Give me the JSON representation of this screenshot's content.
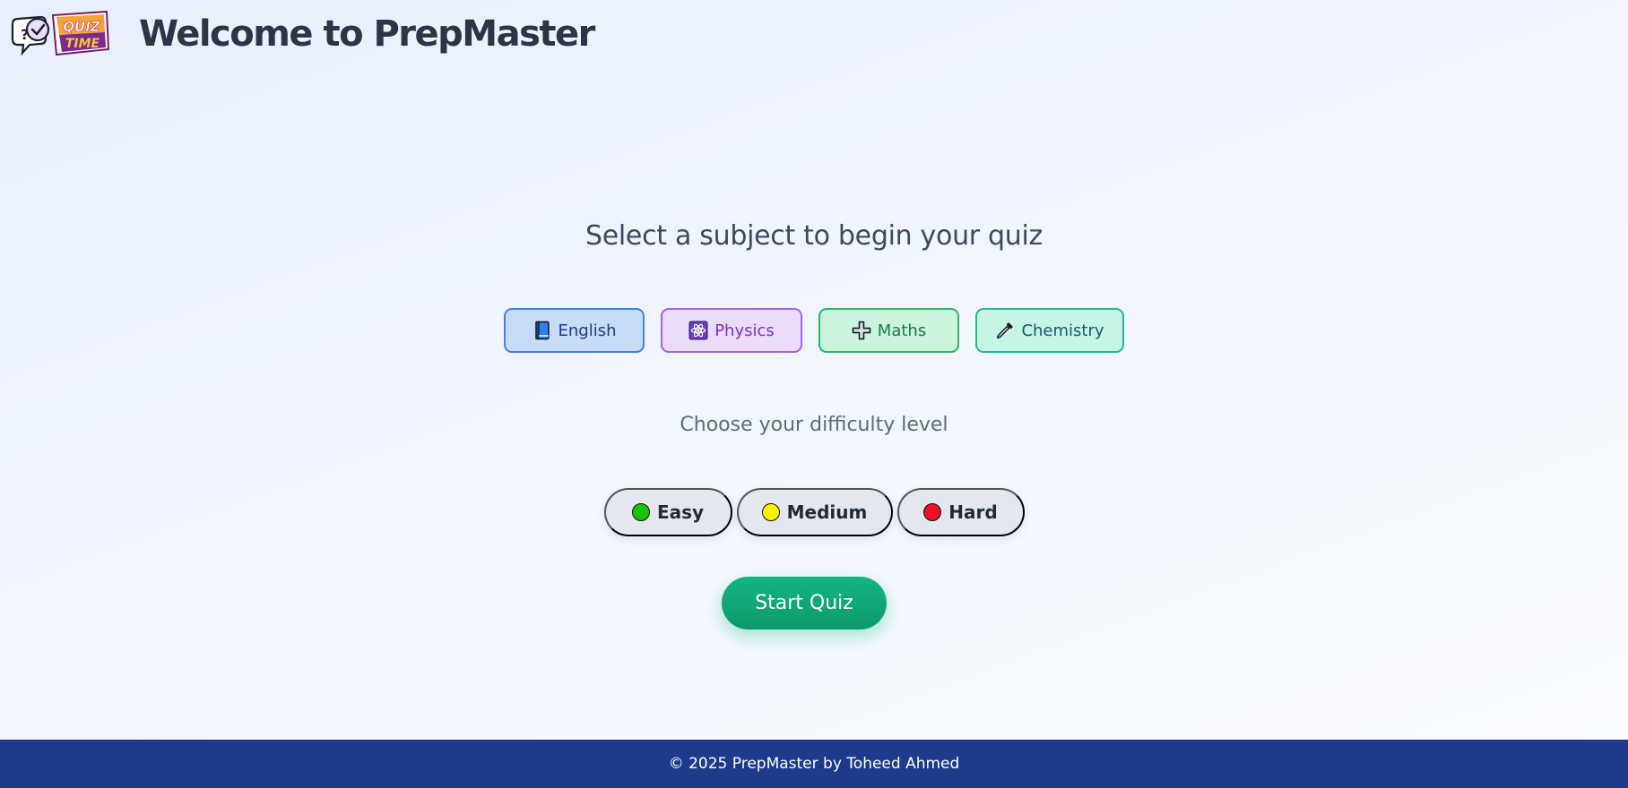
{
  "header": {
    "logo": {
      "line1": "QUIZ",
      "line2": "TIME",
      "icon": "quiz-time-logo"
    },
    "title": "Welcome to PrepMaster"
  },
  "main": {
    "subtitle": "Select a subject to begin your quiz",
    "subjects": [
      {
        "label": "English",
        "icon": "book-icon",
        "color": "#3f7fe6"
      },
      {
        "label": "Physics",
        "icon": "atom-icon",
        "color": "#a463ef"
      },
      {
        "label": "Maths",
        "icon": "plus-icon",
        "color": "#2bb56c"
      },
      {
        "label": "Chemistry",
        "icon": "pipette-icon",
        "color": "#20b79a"
      }
    ],
    "difficulty_label": "Choose your difficulty level",
    "levels": [
      {
        "label": "Easy",
        "icon": "green-circle-icon",
        "color": "#16c60c"
      },
      {
        "label": "Medium",
        "icon": "yellow-circle-icon",
        "color": "#fff100"
      },
      {
        "label": "Hard",
        "icon": "red-circle-icon",
        "color": "#e81224"
      }
    ],
    "start_button": "Start Quiz",
    "accent": "#10b981"
  },
  "footer": {
    "text": "© 2025 PrepMaster by Toheed Ahmed",
    "background": "#1e3a8a"
  }
}
